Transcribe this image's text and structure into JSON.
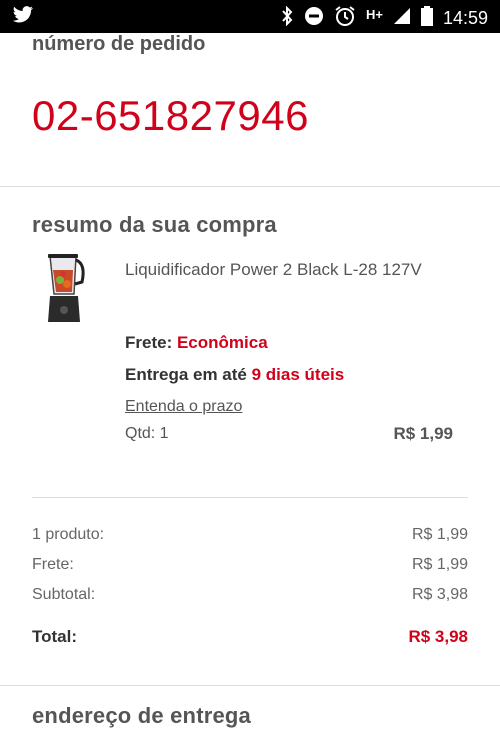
{
  "statusbar": {
    "app_icon": "twitter-bird-icon",
    "network": "H+",
    "time": "14:59",
    "icons": [
      "bluetooth-icon",
      "do-not-disturb-icon",
      "alarm-icon",
      "signal-icon",
      "battery-icon"
    ]
  },
  "order": {
    "label": "número de pedido",
    "number": "02-651827946"
  },
  "summary": {
    "title": "resumo da sua compra",
    "product": {
      "image_icon": "blender-product-image",
      "name": "Liquidificador Power 2 Black L-28 127V",
      "frete_label": "Frete:",
      "frete_value": "Econômica",
      "entrega_label": "Entrega em até",
      "entrega_value": "9 dias úteis",
      "prazo_link": "Entenda o prazo",
      "qtd": "Qtd: 1",
      "price": "R$ 1,99"
    }
  },
  "totals": {
    "rows": [
      {
        "label": "1 produto:",
        "value": "R$ 1,99"
      },
      {
        "label": "Frete:",
        "value": "R$ 1,99"
      },
      {
        "label": "Subtotal:",
        "value": "R$ 3,98"
      }
    ],
    "total_label": "Total:",
    "total_value": "R$ 3,98"
  },
  "address": {
    "title": "endereço de entrega"
  },
  "colors": {
    "accent": "#d0021b",
    "text": "#555555"
  }
}
